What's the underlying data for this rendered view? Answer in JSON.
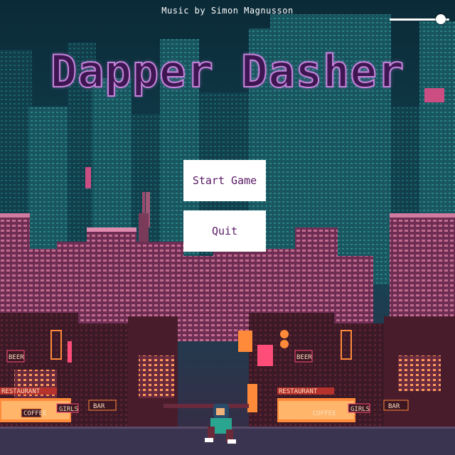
{
  "credit": "Music by Simon Magnusson",
  "volume": {
    "level": 0.86
  },
  "title": "Dapper Dasher",
  "menu": {
    "start_label": "Start Game",
    "quit_label": "Quit"
  },
  "signs": {
    "left": {
      "restaurant": "RESTAURANT",
      "beer": "BEER",
      "coffee": "COFFEE",
      "bar": "BAR",
      "girls": "GIRLS"
    },
    "right": {
      "restaurant": "RESTAURANT",
      "beer": "BEER",
      "coffee": "COFFEE",
      "bar": "BAR",
      "girls": "GIRLS"
    }
  },
  "colors": {
    "sky": "#0d2f3d",
    "title_fill": "#3e1752",
    "title_outline": "#c784dd",
    "button_bg": "#ffffff",
    "button_text": "#5a1a66",
    "neon_orange": "#ff8a3a",
    "neon_pink": "#ff4d7a",
    "shop_red": "#b6322c"
  }
}
